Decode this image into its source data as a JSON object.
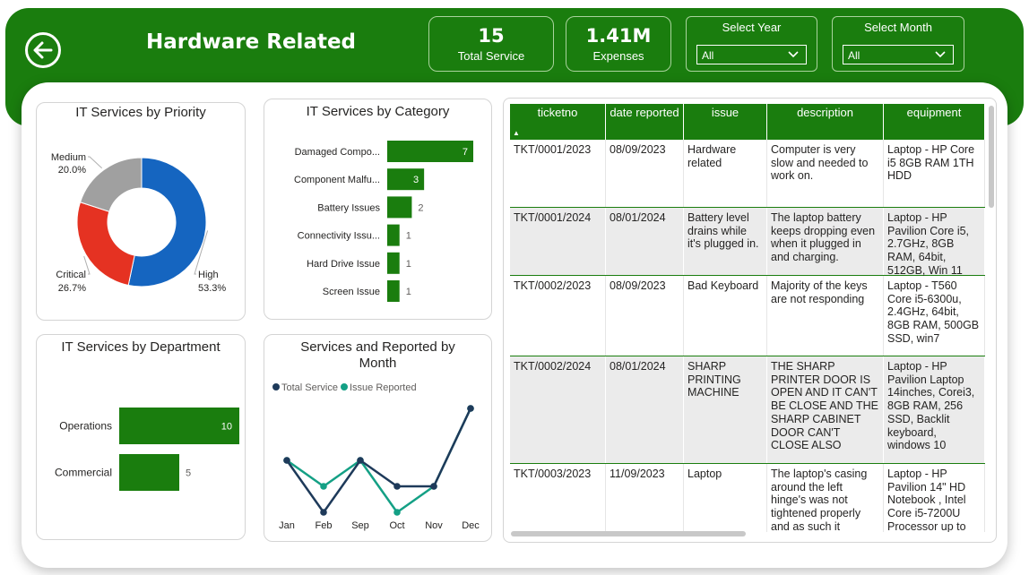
{
  "header": {
    "title": "Hardware Related",
    "kpis": [
      {
        "value": "15",
        "label": "Total Service"
      },
      {
        "value": "1.41M",
        "label": "Expenses"
      }
    ],
    "slicers": [
      {
        "label": "Select Year",
        "value": "All"
      },
      {
        "label": "Select Month",
        "value": "All"
      }
    ]
  },
  "colors": {
    "brand_green": "#1a7d0e",
    "high": "#1565c0",
    "critical": "#e53222",
    "medium": "#a0a0a0",
    "series_total": "#1e3a5a",
    "series_issue": "#14a085"
  },
  "chart_data": [
    {
      "type": "pie",
      "title": "IT Services by Priority",
      "categories": [
        "High",
        "Critical",
        "Medium"
      ],
      "values": [
        53.3,
        26.7,
        20.0
      ],
      "labels": [
        "53.3%",
        "26.7%",
        "20.0%"
      ],
      "donut": true
    },
    {
      "type": "bar",
      "orientation": "horizontal",
      "title": "IT Services by Category",
      "categories": [
        "Damaged Compo...",
        "Component Malfu...",
        "Battery Issues",
        "Connectivity Issu...",
        "Hard Drive Issue",
        "Screen Issue"
      ],
      "values": [
        7,
        3,
        2,
        1,
        1,
        1
      ]
    },
    {
      "type": "bar",
      "orientation": "horizontal",
      "title": "IT Services by Department",
      "categories": [
        "Operations",
        "Commercial"
      ],
      "values": [
        10,
        5
      ]
    },
    {
      "type": "line",
      "title": "Services and Reported by Month",
      "categories": [
        "Jan",
        "Feb",
        "Sep",
        "Oct",
        "Nov",
        "Dec"
      ],
      "series": [
        {
          "name": "Total Service",
          "values": [
            2,
            1,
            2,
            1.5,
            1.5,
            3
          ]
        },
        {
          "name": "Issue Reported",
          "values": [
            2,
            1.5,
            2,
            1,
            1.5,
            3
          ]
        }
      ],
      "legend": "top-left"
    }
  ],
  "table": {
    "columns": [
      "ticketno",
      "date reported",
      "issue",
      "description",
      "equipment"
    ],
    "sort_indicator": "▲",
    "rows": [
      [
        "TKT/0001/2023",
        "08/09/2023",
        "Hardware related",
        "Computer is very slow and needed to work on.",
        "Laptop - HP Core i5 8GB RAM 1TH HDD"
      ],
      [
        "TKT/0001/2024",
        "08/01/2024",
        "Battery level drains while it's plugged in.",
        "The laptop battery keeps dropping even when it plugged in and charging.",
        "Laptop - HP Pavilion Core i5, 2.7GHz, 8GB RAM, 64bit, 512GB, Win 11"
      ],
      [
        "TKT/0002/2023",
        "08/09/2023",
        "Bad Keyboard",
        "Majority of the keys are not responding",
        "Laptop - T560 Core i5-6300u, 2.4GHz, 64bit, 8GB RAM, 500GB SSD, win7"
      ],
      [
        "TKT/0002/2024",
        "08/01/2024",
        "SHARP PRINTING MACHINE",
        "THE SHARP PRINTER DOOR IS OPEN AND IT CAN'T BE CLOSE AND THE SHARP CABINET DOOR CAN'T CLOSE ALSO",
        "Laptop - HP Pavilion Laptop 14inches, Corei3, 8GB RAM, 256 SSD, Backlit keyboard, windows 10"
      ],
      [
        "TKT/0003/2023",
        "11/09/2023",
        "Laptop",
        "The laptop's casing around the left hinge's was not tightened properly and as such it",
        "Laptop - HP Pavilion 14\" HD Notebook , Intel Core i5-7200U Processor up to"
      ]
    ]
  }
}
